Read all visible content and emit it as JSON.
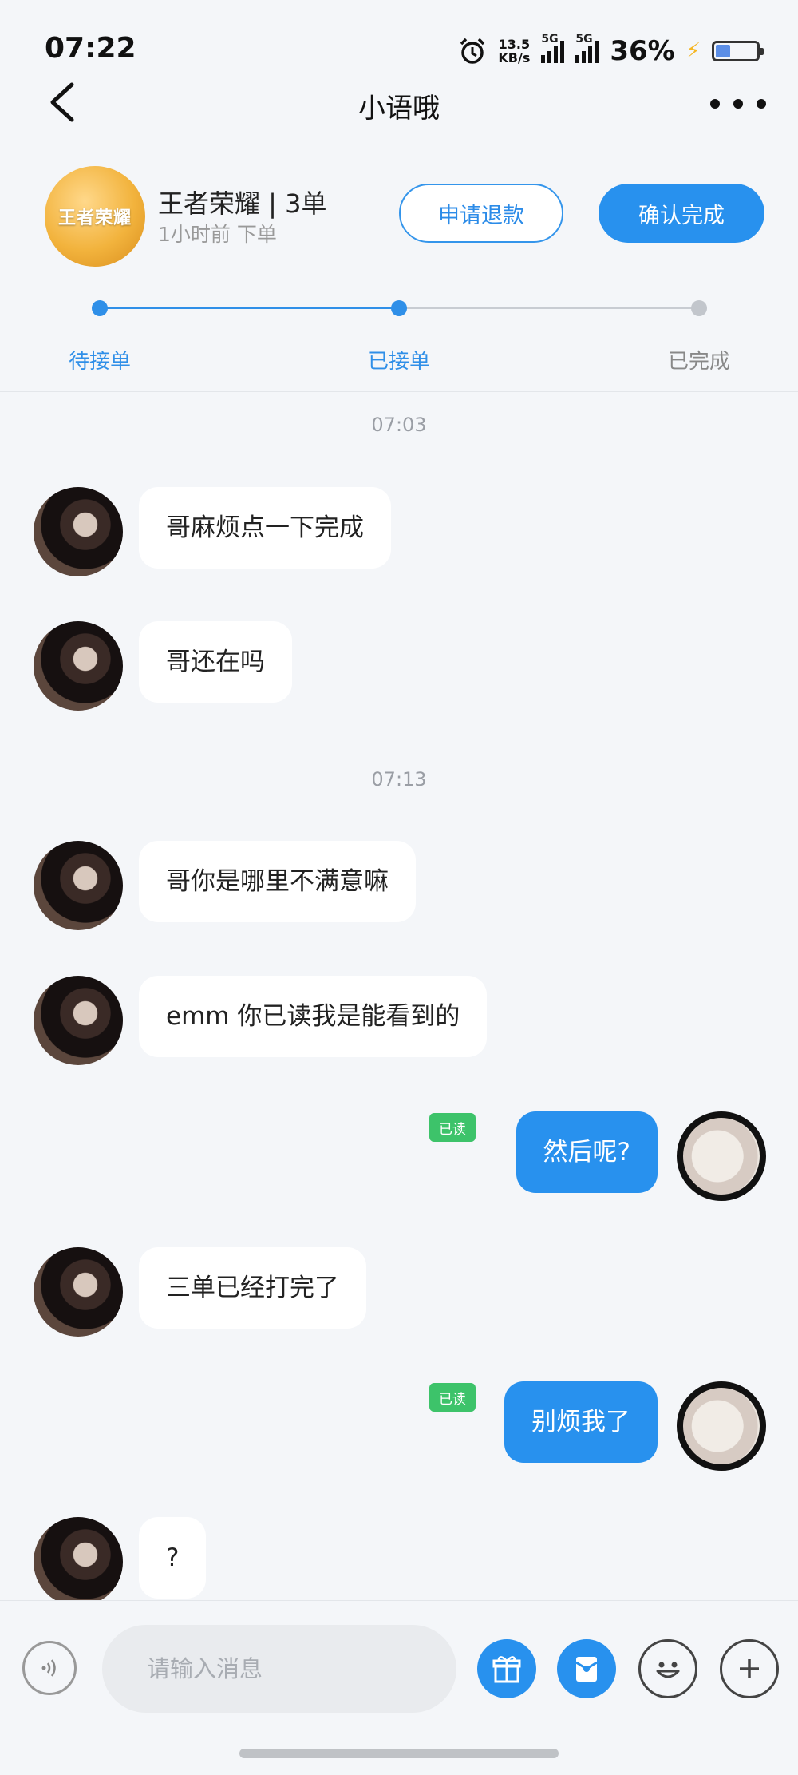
{
  "status_bar": {
    "time": "07:22",
    "net_speed_value": "13.5",
    "net_speed_unit": "KB/s",
    "sim1_label": "5G",
    "sim2_label": "5G",
    "battery_percent": "36%",
    "battery_level": 0.36
  },
  "header": {
    "title": "小语哦"
  },
  "order": {
    "game_logo_text": "王者荣耀",
    "title": "王者荣耀 | 3单",
    "subtitle": "1小时前 下单",
    "refund_label": "申请退款",
    "confirm_label": "确认完成",
    "steps": [
      {
        "label": "待接单",
        "state": "done"
      },
      {
        "label": "已接单",
        "state": "done"
      },
      {
        "label": "已完成",
        "state": "todo"
      }
    ]
  },
  "chat": {
    "read_label": "已读",
    "timestamps": [
      "07:03",
      "07:13"
    ],
    "messages": [
      {
        "from": "other",
        "text": "哥麻烦点一下完成"
      },
      {
        "from": "other",
        "text": "哥还在吗"
      },
      {
        "from": "other",
        "text": "哥你是哪里不满意嘛"
      },
      {
        "from": "other",
        "text": "emm 你已读我是能看到的"
      },
      {
        "from": "me",
        "text": "然后呢?",
        "read": true
      },
      {
        "from": "other",
        "text": "三单已经打完了"
      },
      {
        "from": "me",
        "text": "别烦我了",
        "read": true
      },
      {
        "from": "other",
        "text": "?"
      }
    ]
  },
  "input": {
    "placeholder": "请输入消息",
    "value": ""
  },
  "colors": {
    "accent": "#2891ee",
    "read_badge": "#3dc36a",
    "background": "#f4f6f9"
  }
}
